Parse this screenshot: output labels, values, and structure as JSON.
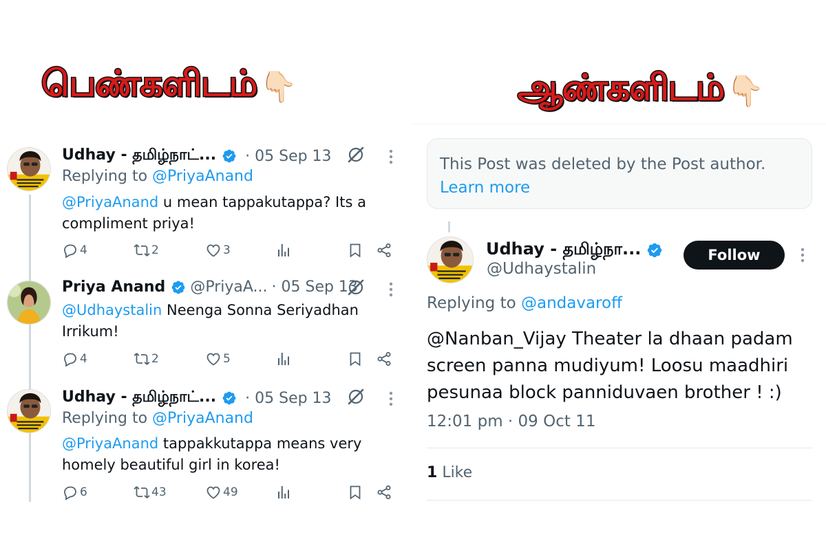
{
  "headings": {
    "left": "பெண்களிடம்",
    "right": "ஆண்களிடம்",
    "hand_icon": "👇🏻"
  },
  "left_thread": [
    {
      "name": "Udhay - தமிழ்நாட்...",
      "handle": "",
      "date": "· 05 Sep 13",
      "replying_prefix": "Replying to",
      "replying_to": "@PriyaAnand",
      "mention": "@PriyaAnand",
      "text": " u mean tappakutappa? Its a compliment priya!",
      "counts": {
        "replies": "4",
        "reposts": "2",
        "likes": "3"
      }
    },
    {
      "name": "Priya Anand",
      "handle": "@PriyaA...",
      "date": "· 05 Sep 13",
      "replying_prefix": "",
      "replying_to": "",
      "mention": "@Udhaystalin",
      "text": " Neenga Sonna Seriyadhan Irrikum!",
      "counts": {
        "replies": "4",
        "reposts": "2",
        "likes": "5"
      }
    },
    {
      "name": "Udhay - தமிழ்நாட்...",
      "handle": "",
      "date": "· 05 Sep 13",
      "replying_prefix": "Replying to",
      "replying_to": "@PriyaAnand",
      "mention": "@PriyaAnand",
      "text": " tappakkutappa means very homely beautiful girl in korea!",
      "counts": {
        "replies": "6",
        "reposts": "43",
        "likes": "49"
      }
    }
  ],
  "right_post": {
    "deleted_notice": "This Post was deleted by the Post author.",
    "learn_more": "Learn more",
    "name": "Udhay - தமிழ்நா...",
    "handle": "@Udhaystalin",
    "follow_label": "Follow",
    "replying_prefix": "Replying to",
    "replying_to": "@andavaroff",
    "text": "@Nanban_Vijay Theater la dhaan padam screen panna mudiyum! Loosu maadhiri pesunaa block panniduvaen brother ! :)",
    "timestamp": "12:01 pm · 09 Oct 11",
    "like_count": "1",
    "like_label": "Like"
  },
  "colors": {
    "accent": "#1d9bf0",
    "heading_red": "#d91a1a",
    "muted_text": "#536471",
    "follow_button": "#0f1419"
  },
  "icons": [
    "pointing-down-hand-icon",
    "verified-badge-icon",
    "grok-icon",
    "more-icon",
    "reply-icon",
    "repost-icon",
    "like-icon",
    "views-icon",
    "bookmark-icon",
    "share-icon"
  ]
}
